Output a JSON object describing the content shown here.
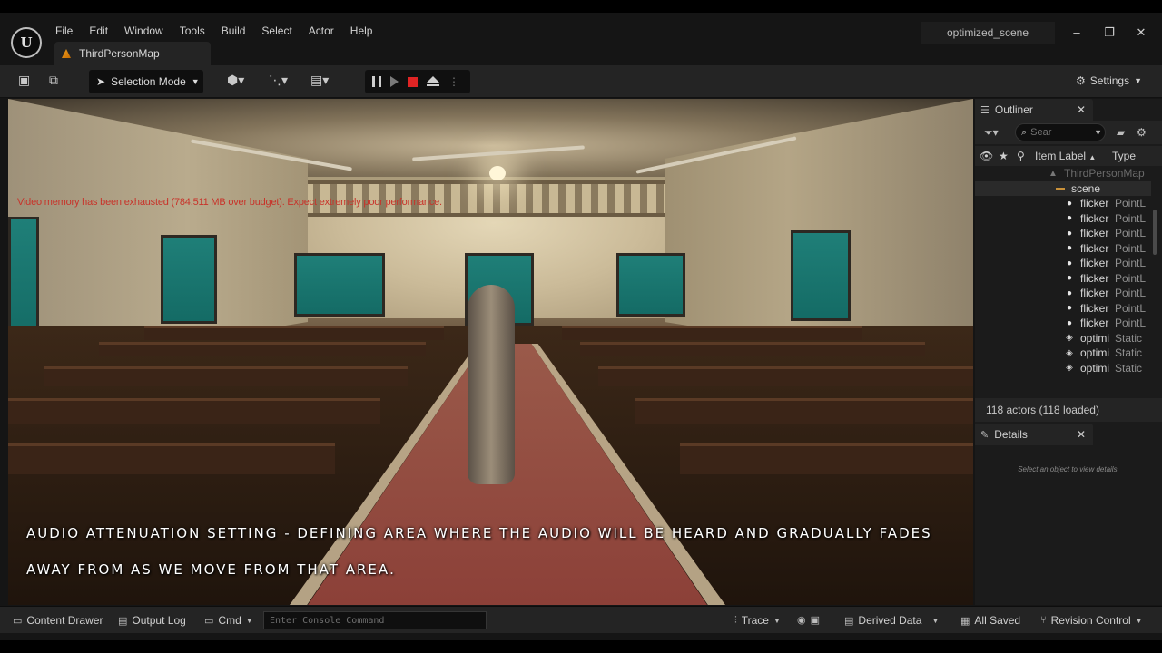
{
  "window": {
    "project_name": "optimized_scene",
    "minimize": "–",
    "restore": "❐",
    "close": "✕"
  },
  "menu": [
    "File",
    "Edit",
    "Window",
    "Tools",
    "Build",
    "Select",
    "Actor",
    "Help"
  ],
  "document_tab": {
    "label": "ThirdPersonMap"
  },
  "toolbar": {
    "mode_label": "Selection Mode",
    "settings_label": "Settings"
  },
  "viewport": {
    "warning": "Video memory has been exhausted (784.511 MB over budget). Expect extremely poor performance.",
    "caption": "Audio attenuation setting - defining area where the audio will be heard and gradually fades away from as we move from that area."
  },
  "outliner": {
    "title": "Outliner",
    "search_placeholder": "Sear",
    "columns": {
      "label": "Item Label",
      "sort": "▲",
      "type": "Type"
    },
    "rows": [
      {
        "label": "ThirdPersonMap",
        "type": "",
        "icon": "map-icon",
        "indent": 1,
        "dim": true
      },
      {
        "label": "scene",
        "type": "",
        "icon": "folder-icon",
        "indent": 2,
        "dim": false
      },
      {
        "label": "flicker",
        "type": "PointL",
        "icon": "light-icon",
        "indent": 3,
        "dim": false
      },
      {
        "label": "flicker",
        "type": "PointL",
        "icon": "light-icon",
        "indent": 3,
        "dim": false
      },
      {
        "label": "flicker",
        "type": "PointL",
        "icon": "light-icon",
        "indent": 3,
        "dim": false
      },
      {
        "label": "flicker",
        "type": "PointL",
        "icon": "light-icon",
        "indent": 3,
        "dim": false
      },
      {
        "label": "flicker",
        "type": "PointL",
        "icon": "light-icon",
        "indent": 3,
        "dim": false
      },
      {
        "label": "flicker",
        "type": "PointL",
        "icon": "light-icon",
        "indent": 3,
        "dim": false
      },
      {
        "label": "flicker",
        "type": "PointL",
        "icon": "light-icon",
        "indent": 3,
        "dim": false
      },
      {
        "label": "flicker",
        "type": "PointL",
        "icon": "light-icon",
        "indent": 3,
        "dim": false
      },
      {
        "label": "flicker",
        "type": "PointL",
        "icon": "light-icon",
        "indent": 3,
        "dim": false
      },
      {
        "label": "optimi",
        "type": "Static",
        "icon": "static-mesh-icon",
        "indent": 3,
        "dim": false
      },
      {
        "label": "optimi",
        "type": "Static",
        "icon": "static-mesh-icon",
        "indent": 3,
        "dim": false
      },
      {
        "label": "optimi",
        "type": "Static",
        "icon": "static-mesh-icon",
        "indent": 3,
        "dim": false
      }
    ],
    "actor_count": "118 actors (118 loaded)"
  },
  "details": {
    "title": "Details",
    "empty_message": "Select an object to view details."
  },
  "statusbar": {
    "content_drawer": "Content Drawer",
    "output_log": "Output Log",
    "cmd": "Cmd",
    "console_placeholder": "Enter Console Command",
    "trace": "Trace",
    "derived_data": "Derived Data",
    "all_saved": "All Saved",
    "revision_control": "Revision Control"
  },
  "colors": {
    "panel_bg": "#242424",
    "app_bg": "#151515",
    "stop_red": "#e02424",
    "warning_red": "#c8332a",
    "tab_accent": "#f0a020"
  }
}
